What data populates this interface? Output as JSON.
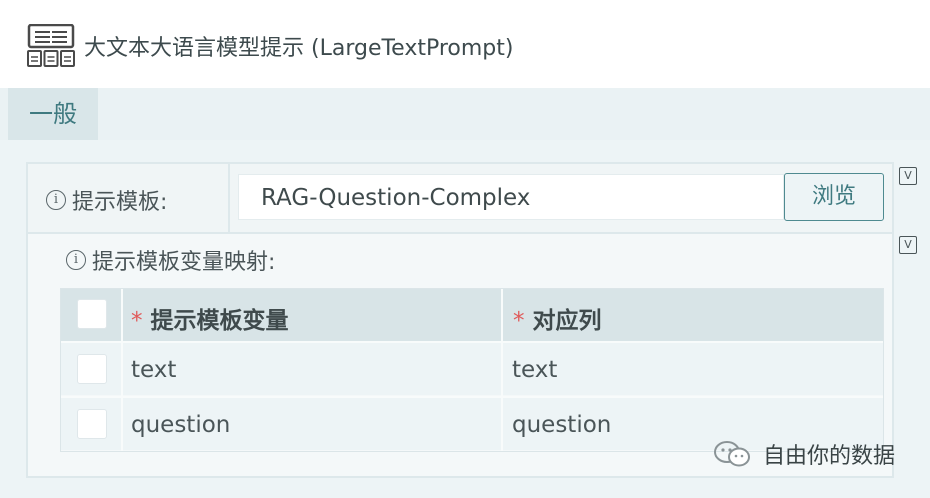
{
  "window": {
    "title": "大文本大语言模型提示 (LargeTextPrompt)",
    "icon": "book-grid-icon"
  },
  "tabs": [
    {
      "label": "一般",
      "active": true
    }
  ],
  "form": {
    "prompt_template": {
      "label": "提示模板:",
      "value": "RAG-Question-Complex",
      "browse_label": "浏览"
    },
    "variable_mapping": {
      "label": "提示模板变量映射:",
      "columns": [
        "提示模板变量",
        "对应列"
      ],
      "required_mark": "*",
      "rows": [
        {
          "variable": "text",
          "column": "text"
        },
        {
          "variable": "question",
          "column": "question"
        }
      ]
    }
  },
  "watermark": {
    "text": "自由你的数据",
    "icon": "wechat-icon"
  },
  "colors": {
    "accent": "#3f7a80",
    "panel_bg": "#edf4f6",
    "header_bg": "#d8e4e7",
    "required": "#e05a5a"
  }
}
